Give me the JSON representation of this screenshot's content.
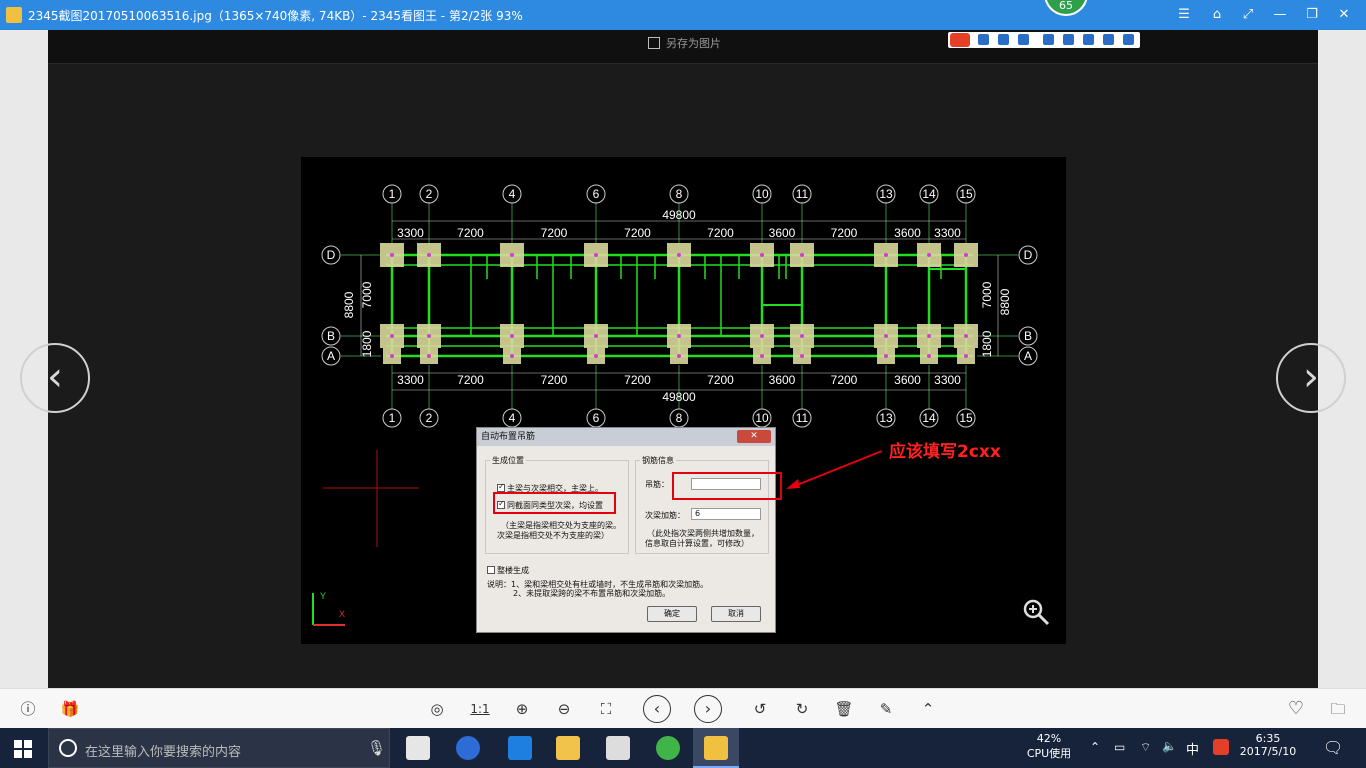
{
  "window": {
    "title": "2345截图20170510063516.jpg（1365×740像素, 74KB）- 2345看图王 - 第2/2张 93%",
    "badge": "65",
    "buttons": [
      "☰",
      "⌂",
      "⤢",
      "—",
      "❐",
      "✕"
    ]
  },
  "viewer": {
    "save_as": "另存为图片",
    "zoom_icon": "zoom-in-icon"
  },
  "drawing": {
    "top_axes": [
      "1",
      "2",
      "4",
      "6",
      "8",
      "10",
      "11",
      "13",
      "14",
      "15"
    ],
    "row_axes": [
      "D",
      "B",
      "A"
    ],
    "total_dim": "49800",
    "bay_dims": [
      "3300",
      "7200",
      "7200",
      "7200",
      "7200",
      "3600",
      "7200",
      "3600",
      "3300"
    ],
    "side_dims_outer": "8800",
    "side_dims_inner_top": "7000",
    "side_dims_inner_bottom": "1800",
    "axis_y": "Y",
    "axis_x": "X"
  },
  "dialog": {
    "title": "自动布置吊筋",
    "close": "✕",
    "group_position": "生成位置",
    "opt1": "主梁与次梁相交，主梁上。",
    "opt2": "同截面同类型次梁，均设置",
    "note1": "（主梁是指梁相交处为支座的梁。",
    "note2": "次梁是指相交处不为支座的梁）",
    "group_rebar": "钢筋信息",
    "hanger_label": "吊筋：",
    "hanger_value": "",
    "secondary_label": "次梁加筋：",
    "secondary_value": "6",
    "rebar_note1": "（此处指次梁两侧共增加数量，",
    "rebar_note2": "信息取自计算设置，可修改）",
    "whole_floor": "整楼生成",
    "desc1": "说明：1、梁和梁相交处有柱或墙时，不生成吊筋和次梁加筋。",
    "desc2": "2、未提取梁跨的梁不布置吊筋和次梁加筋。",
    "ok": "确定",
    "cancel": "取消"
  },
  "annotation": {
    "text": "应该填写2cxx",
    "color": "#ff2020"
  },
  "bottom_toolbar": {
    "info": "ⓘ",
    "gift": "🎁",
    "actual_size": "1:1",
    "favorite": "♡",
    "folder": "🗀"
  },
  "taskbar": {
    "search_placeholder": "在这里输入你要搜索的内容",
    "cpu_percent": "42%",
    "cpu_label": "CPU使用",
    "ime": "中",
    "time": "6:35",
    "date": "2017/5/10"
  },
  "colors": {
    "titlebar": "#2d8ae0",
    "beam": "#22dd22",
    "column": "#d8d89a",
    "annotation_red": "#e4000f"
  }
}
